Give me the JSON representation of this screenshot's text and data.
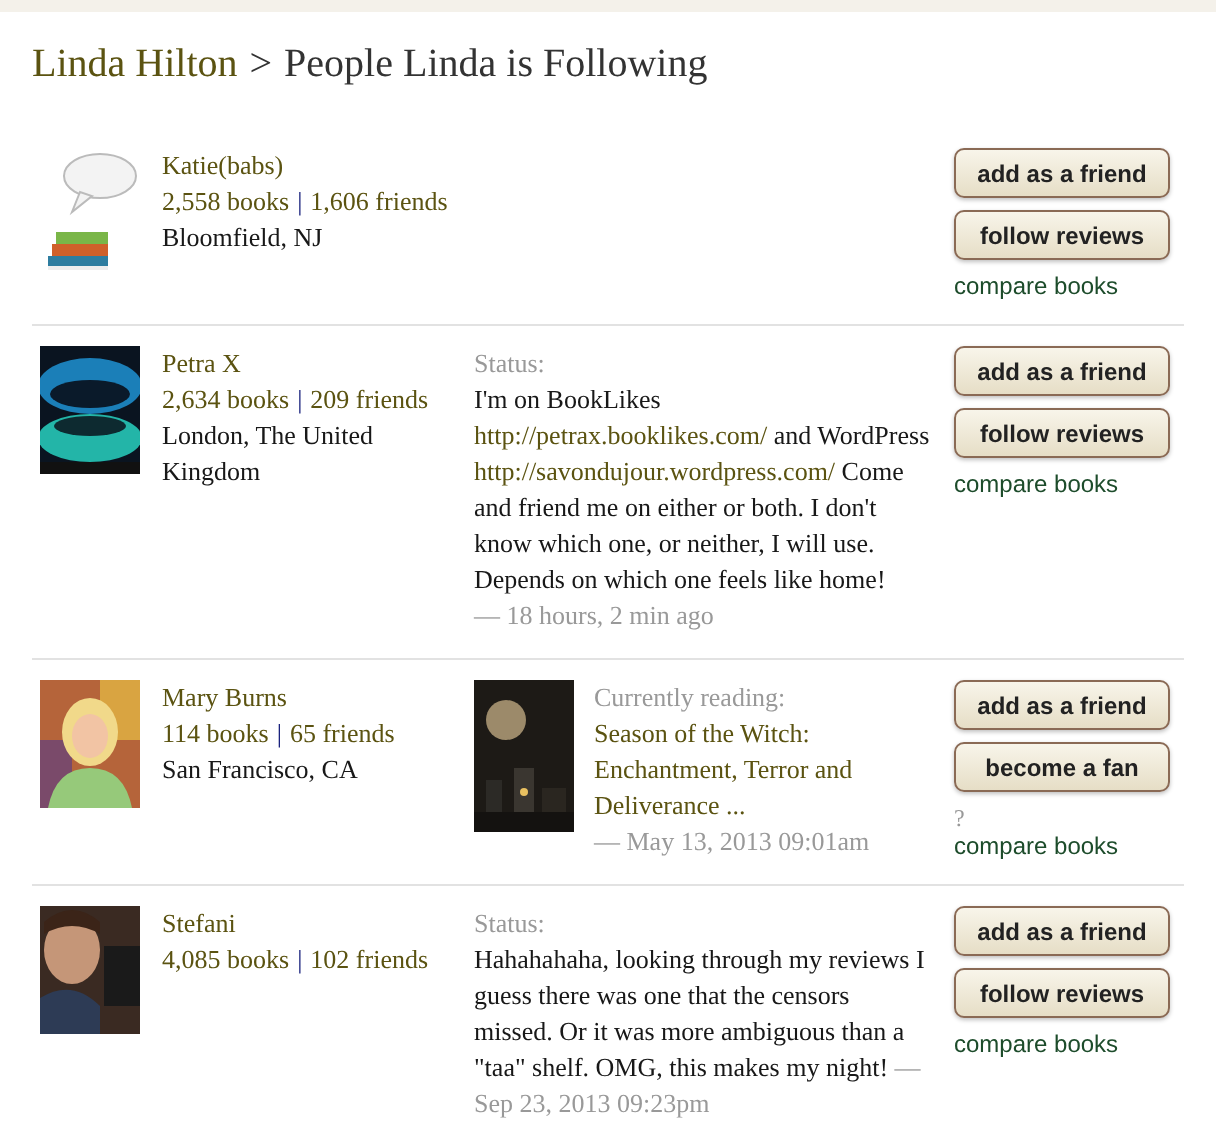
{
  "heading": {
    "owner": "Linda Hilton",
    "separator": ">",
    "title": "People Linda is Following"
  },
  "people": [
    {
      "name": "Katie(babs)",
      "books": "2,558 books",
      "separator": "|",
      "friends": "1,606 friends",
      "location": "Bloomfield, NJ",
      "buttons": [
        "add as a friend",
        "follow reviews"
      ],
      "compare": "compare books"
    },
    {
      "name": "Petra X",
      "books": "2,634 books",
      "separator": "|",
      "friends": "209 friends",
      "location": "London, The United Kingdom",
      "activity": {
        "kind": "status",
        "label": "Status:",
        "parts": [
          {
            "kind": "text",
            "text": "I'm on BookLikes "
          },
          {
            "kind": "link",
            "text": "http://petrax.booklikes.com/"
          },
          {
            "kind": "text",
            "text": " and WordPress "
          },
          {
            "kind": "link",
            "text": "http://savondujour.wordpress.com/"
          },
          {
            "kind": "text",
            "text": " Come and friend me on either or both. I don't know which one, or neither, I will use. Depends on which one feels like home! "
          }
        ],
        "time": "— 18 hours, 2 min ago"
      },
      "buttons": [
        "add as a friend",
        "follow reviews"
      ],
      "compare": "compare books"
    },
    {
      "name": "Mary Burns",
      "books": "114 books",
      "separator": "|",
      "friends": "65 friends",
      "location": "San Francisco, CA",
      "activity": {
        "kind": "reading",
        "label": "Currently reading:",
        "book": "Season of the Witch: Enchantment, Terror and Deliverance ...",
        "time": "— May 13, 2013 09:01am"
      },
      "buttons": [
        "add as a friend",
        "become a fan"
      ],
      "note": "?",
      "compare": "compare books"
    },
    {
      "name": "Stefani",
      "books": "4,085 books",
      "separator": "|",
      "friends": "102 friends",
      "activity": {
        "kind": "status",
        "label": "Status:",
        "parts": [
          {
            "kind": "text",
            "text": "Hahahahaha, looking through my reviews I guess there was one that the censors missed. Or it was more ambiguous than a \"taa\" shelf. OMG, this makes my night! "
          }
        ],
        "time": "Sep 23, 2013 09:23pm",
        "time_prefix": "—"
      },
      "buttons": [
        "add as a friend",
        "follow reviews"
      ],
      "compare": "compare books"
    }
  ]
}
